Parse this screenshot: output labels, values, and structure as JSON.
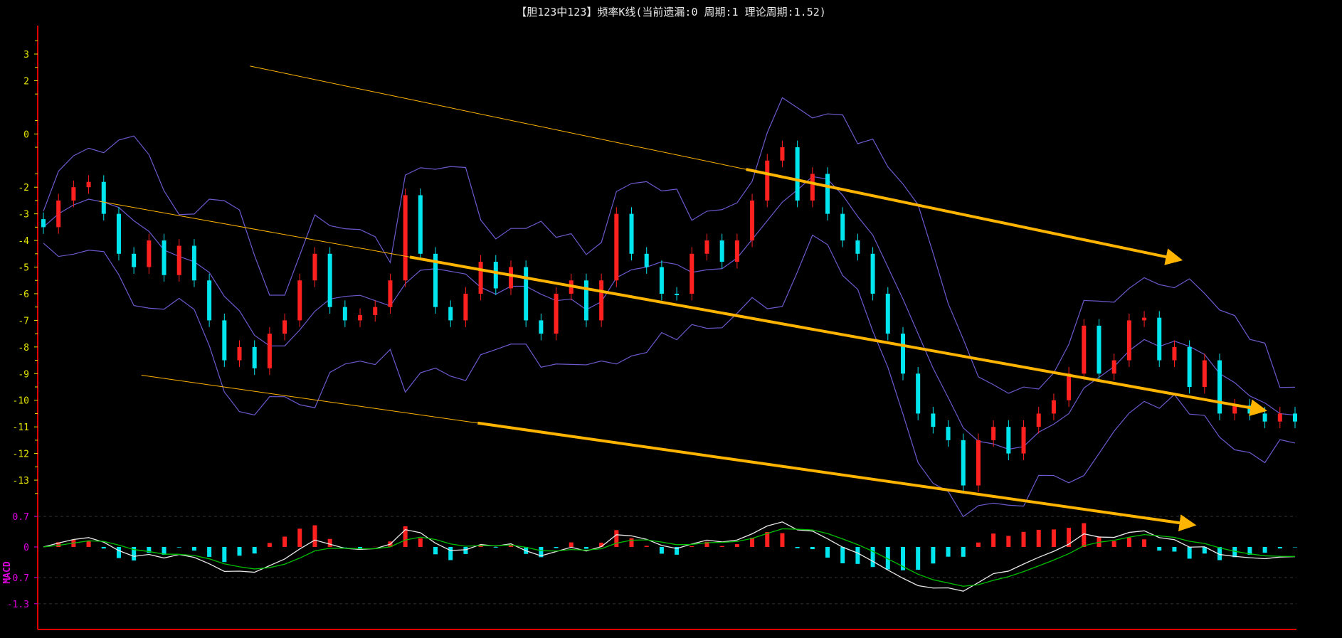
{
  "title": "【胆123中123】频率K线(当前遗漏:0 周期:1 理论周期:1.52)",
  "colors": {
    "up": "#ff2020",
    "down": "#00e5ee",
    "band": "#6a5acd",
    "axis": "#e00000",
    "ytick": "#e6e600",
    "macd_tick": "#e000e0",
    "dif": "#e8e8e8",
    "dea": "#00c000",
    "trend": "#ffb400"
  },
  "chart_data": [
    {
      "type": "candlestick",
      "title": "",
      "yticks": [
        3,
        2,
        0,
        -2,
        -3,
        -4,
        -5,
        -6,
        -7,
        -8,
        -9,
        -10,
        -11,
        -12,
        -13
      ],
      "ylim": [
        3.9,
        -13.9
      ],
      "close": [
        -3.5,
        -2.5,
        -2,
        -1.8,
        -3,
        -4.5,
        -5,
        -4,
        -5.3,
        -4.2,
        -5.5,
        -7,
        -8.5,
        -8,
        -8.8,
        -7.5,
        -7,
        -5.5,
        -4.5,
        -6.5,
        -7,
        -6.8,
        -6.5,
        -5.5,
        -2.3,
        -4.5,
        -6.5,
        -7,
        -6,
        -4.8,
        -5.8,
        -5,
        -7,
        -7.5,
        -6,
        -5.5,
        -7,
        -5.5,
        -3,
        -4.5,
        -5,
        -6,
        -6,
        -4.5,
        -4,
        -4.8,
        -4,
        -2.5,
        -1,
        -0.5,
        -2.5,
        -1.5,
        -3,
        -4,
        -4.5,
        -6,
        -7.5,
        -9,
        -10.5,
        -11,
        -11.5,
        -13.2,
        -11.5,
        -11,
        -12,
        -11,
        -10.5,
        -10,
        -9,
        -7.2,
        -9,
        -8.5,
        -7,
        -6.9,
        -8.5,
        -8,
        -9.5,
        -8.5,
        -10.5,
        -10.2,
        -10.5,
        -10.8,
        -10.5,
        -10.8
      ],
      "trendlines": [
        {
          "from": [
            13.7,
            2.55
          ],
          "thick_from": 46.6,
          "to": [
            75.0,
            -4.68
          ]
        },
        {
          "from": [
            3.7,
            -2.53
          ],
          "thick_from": 24.3,
          "to": [
            80.6,
            -10.34
          ]
        },
        {
          "from": [
            6.5,
            -9.06
          ],
          "thick_from": 28.8,
          "to": [
            75.9,
            -14.65
          ]
        }
      ]
    },
    {
      "type": "macd",
      "label": "MACD",
      "yticks": [
        {
          "v": 0.7,
          "t": "0.7"
        },
        {
          "v": 0,
          "t": "0"
        },
        {
          "v": -0.7,
          "t": "-0.7"
        },
        {
          "v": -1.3,
          "t": "-1.3"
        }
      ]
    }
  ]
}
